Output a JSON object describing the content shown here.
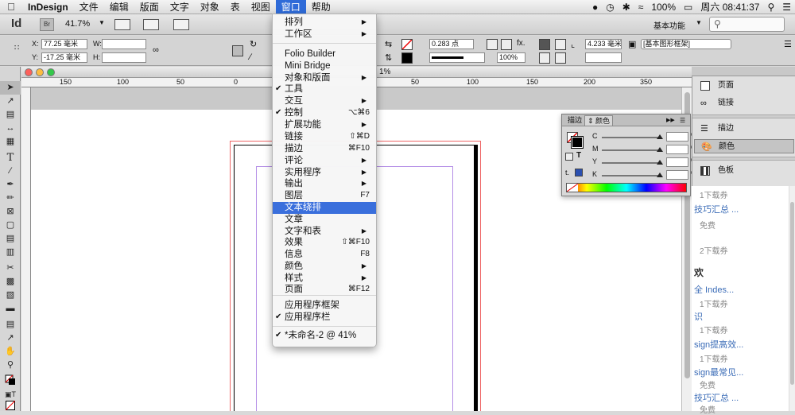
{
  "menubar": {
    "app_name": "InDesign",
    "items": [
      "文件",
      "编辑",
      "版面",
      "文字",
      "对象",
      "表",
      "视图",
      "窗口",
      "帮助"
    ],
    "active_item": "窗口",
    "battery": "100%",
    "clock": "周六 08:41:37"
  },
  "appbar": {
    "logo": "Id",
    "bridge": "Br",
    "zoom": "41.7%",
    "workspace": "基本功能"
  },
  "control": {
    "x_label": "X:",
    "x_value": "77.25 毫米",
    "y_label": "Y:",
    "y_value": "-17.25 毫米",
    "w_label": "W:",
    "h_label": "H:",
    "stroke_weight": "0.283 点",
    "scale": "100%",
    "size_value": "4.233 毫米",
    "object_style": "[基本图形框架]"
  },
  "document": {
    "title": "1%",
    "ruler_labels": [
      "150",
      "100",
      "50",
      "0",
      "50",
      "100",
      "150",
      "200",
      "250",
      "300",
      "350"
    ]
  },
  "window_menu": {
    "items": [
      {
        "label": "排列",
        "shortcut": "",
        "submenu": true,
        "checked": false
      },
      {
        "label": "工作区",
        "shortcut": "",
        "submenu": true,
        "checked": false
      },
      {
        "label": "Folio Builder",
        "shortcut": "",
        "submenu": false,
        "checked": false
      },
      {
        "label": "Mini Bridge",
        "shortcut": "",
        "submenu": false,
        "checked": false
      },
      {
        "label": "对象和版面",
        "shortcut": "",
        "submenu": true,
        "checked": false
      },
      {
        "label": "工具",
        "shortcut": "",
        "submenu": false,
        "checked": true
      },
      {
        "label": "交互",
        "shortcut": "",
        "submenu": true,
        "checked": false
      },
      {
        "label": "控制",
        "shortcut": "⌥⌘6",
        "submenu": false,
        "checked": true
      },
      {
        "label": "扩展功能",
        "shortcut": "",
        "submenu": true,
        "checked": false
      },
      {
        "label": "链接",
        "shortcut": "⇧⌘D",
        "submenu": false,
        "checked": false
      },
      {
        "label": "描边",
        "shortcut": "⌘F10",
        "submenu": false,
        "checked": false
      },
      {
        "label": "评论",
        "shortcut": "",
        "submenu": true,
        "checked": false
      },
      {
        "label": "实用程序",
        "shortcut": "",
        "submenu": true,
        "checked": false
      },
      {
        "label": "输出",
        "shortcut": "",
        "submenu": true,
        "checked": false
      },
      {
        "label": "图层",
        "shortcut": "F7",
        "submenu": false,
        "checked": false
      },
      {
        "label": "文本绕排",
        "shortcut": "",
        "submenu": false,
        "checked": false,
        "highlighted": true
      },
      {
        "label": "文章",
        "shortcut": "",
        "submenu": false,
        "checked": false
      },
      {
        "label": "文字和表",
        "shortcut": "",
        "submenu": true,
        "checked": false
      },
      {
        "label": "效果",
        "shortcut": "⇧⌘F10",
        "submenu": false,
        "checked": false
      },
      {
        "label": "信息",
        "shortcut": "F8",
        "submenu": false,
        "checked": false
      },
      {
        "label": "颜色",
        "shortcut": "",
        "submenu": true,
        "checked": false
      },
      {
        "label": "样式",
        "shortcut": "",
        "submenu": true,
        "checked": false
      },
      {
        "label": "页面",
        "shortcut": "⌘F12",
        "submenu": false,
        "checked": false
      },
      {
        "label": "应用程序框架",
        "shortcut": "",
        "submenu": false,
        "checked": false
      },
      {
        "label": "应用程序栏",
        "shortcut": "",
        "submenu": false,
        "checked": true
      },
      {
        "label": "*未命名-2 @ 41%",
        "shortcut": "",
        "submenu": false,
        "checked": true
      }
    ]
  },
  "color_panel": {
    "tab_stroke": "描边",
    "tab_color": "颜色",
    "channels": [
      "C",
      "M",
      "Y",
      "K"
    ],
    "percent": "%",
    "text_toggle": "T"
  },
  "dock": {
    "items": [
      "页面",
      "链接",
      "描边",
      "颜色",
      "色板"
    ],
    "selected": "颜色"
  },
  "web": {
    "lines": [
      {
        "text": "1下载券",
        "style": "gray"
      },
      {
        "text": "技巧汇总 ...",
        "style": "link"
      },
      {
        "text": "免费",
        "style": "gray"
      },
      {
        "text": "2下载券",
        "style": "gray"
      },
      {
        "text": "欢",
        "style": "head"
      },
      {
        "text": "全 Indes...",
        "style": "link"
      },
      {
        "text": "1下载券",
        "style": "gray"
      },
      {
        "text": "识",
        "style": "link"
      },
      {
        "text": "1下载券",
        "style": "gray"
      },
      {
        "text": "sign提高效...",
        "style": "link"
      },
      {
        "text": "1下载券",
        "style": "gray"
      },
      {
        "text": "sign最常见...",
        "style": "link"
      },
      {
        "text": "免费",
        "style": "gray"
      },
      {
        "text": "技巧汇总 ...",
        "style": "link"
      },
      {
        "text": "免费",
        "style": "gray"
      }
    ]
  },
  "colors": {
    "menu_highlight": "#3a6fdc",
    "bleed_guide": "#ee6666",
    "margin_guide": "#b48ee6",
    "link_blue": "#3b6cb7"
  }
}
